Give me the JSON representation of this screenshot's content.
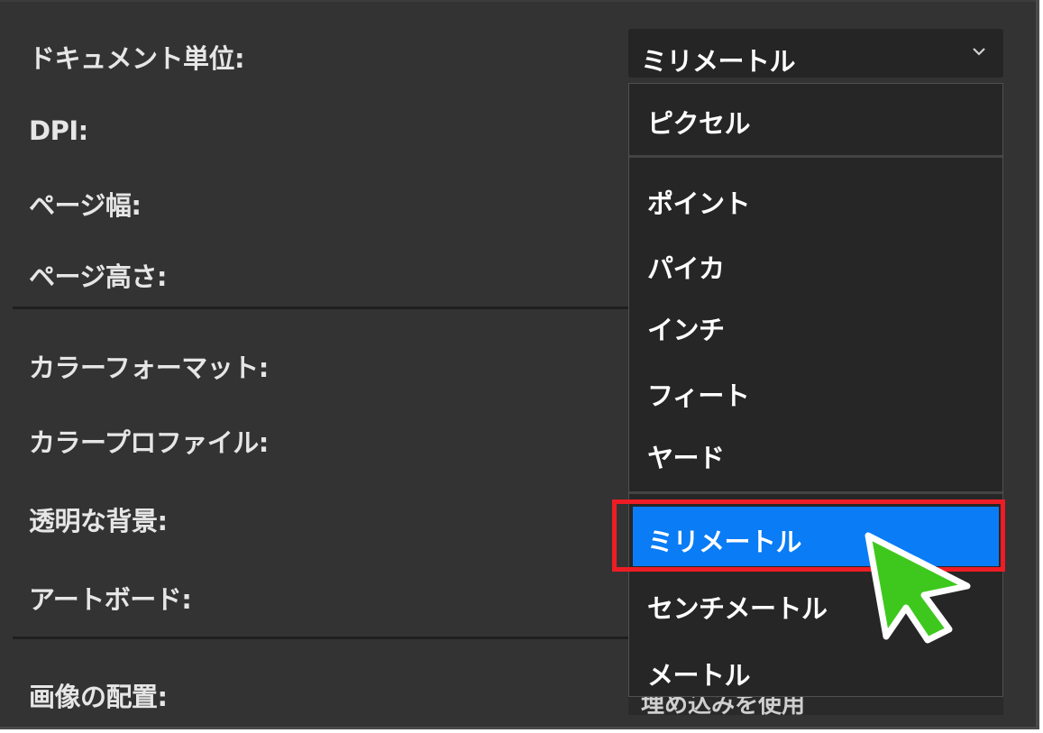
{
  "settings": {
    "labels": {
      "document_unit": "ドキュメント単位:",
      "dpi": "DPI:",
      "page_width": "ページ幅:",
      "page_height": "ページ高さ:",
      "color_format": "カラーフォーマット:",
      "color_profile": "カラープロファイル:",
      "transparent_bg": "透明な背景:",
      "artboard": "アートボード:",
      "image_placement": "画像の配置:"
    },
    "unit_select": {
      "value": "ミリメートル",
      "options": [
        "ピクセル",
        "ポイント",
        "パイカ",
        "インチ",
        "フィート",
        "ヤード",
        "ミリメートル",
        "センチメートル",
        "メートル"
      ],
      "selected_index": 6
    },
    "obscured_value": "埋め込みを使用"
  },
  "colors": {
    "panel_bg": "#333333",
    "dropdown_bg": "#262626",
    "selected_bg": "#0a7cf5",
    "highlight_border": "#ee1c24",
    "cursor_fill": "#3ec81e"
  },
  "icons": {
    "chevron": "chevron-down-icon",
    "cursor": "pointer-cursor-icon"
  }
}
